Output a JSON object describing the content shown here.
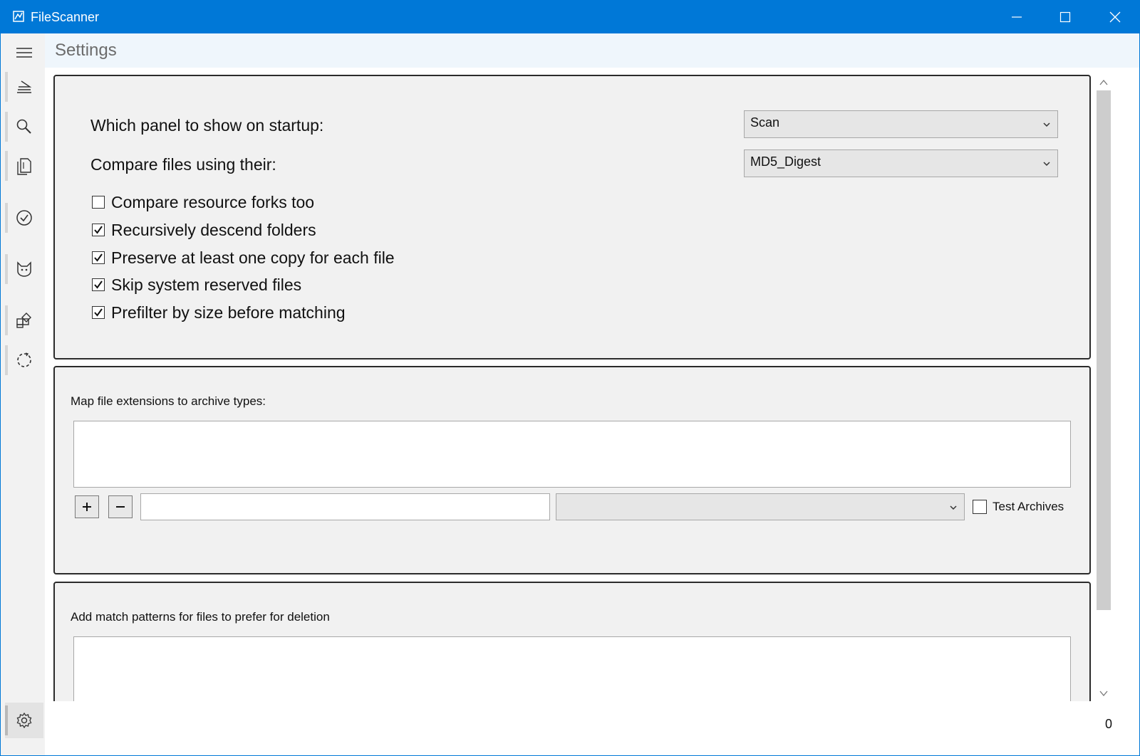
{
  "window": {
    "title": "FileScanner",
    "accent": "#0078d7"
  },
  "header": {
    "page_title": "Settings"
  },
  "nav": [
    "scan-icon",
    "search-icon",
    "copy-icon",
    "check-circle-icon",
    "cat-icon",
    "apps-icon",
    "refresh-icon",
    "gear-icon"
  ],
  "general": {
    "startup_label": "Which panel to show on startup:",
    "startup_value": "Scan",
    "compare_label": "Compare files using their:",
    "compare_value": "MD5_Digest",
    "options": [
      {
        "label": "Compare resource forks too",
        "checked": false
      },
      {
        "label": "Recursively descend folders",
        "checked": true
      },
      {
        "label": "Preserve at least one copy for each file",
        "checked": true
      },
      {
        "label": "Skip system reserved files",
        "checked": true
      },
      {
        "label": "Prefilter by size before matching",
        "checked": true
      }
    ]
  },
  "archives": {
    "label": "Map file extensions to archive types:",
    "extension_value": "",
    "type_value": "",
    "test_archives_label": "Test Archives",
    "test_archives_checked": false
  },
  "deletion": {
    "label": "Add match patterns for files to prefer for deletion"
  },
  "status": {
    "count": "0"
  }
}
